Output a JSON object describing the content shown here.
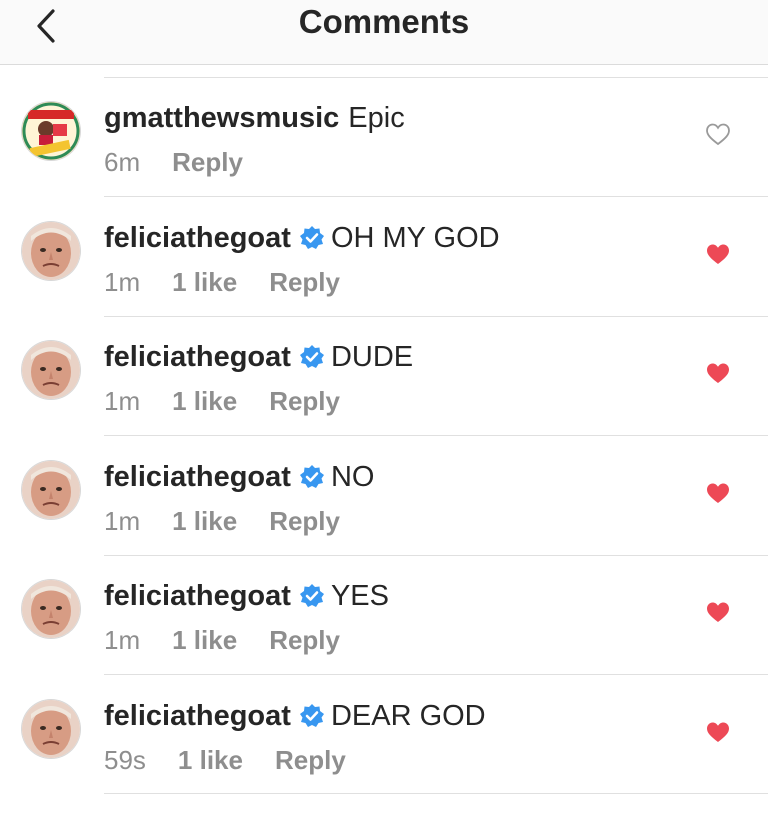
{
  "header": {
    "title": "Comments"
  },
  "comments": [
    {
      "username": "gmatthewsmusic",
      "verified": false,
      "text": "Epic",
      "time": "6m",
      "likes": "",
      "reply": "Reply",
      "liked": false,
      "avatar": "gmatthewsmusic-avatar"
    },
    {
      "username": "feliciathegoat",
      "verified": true,
      "text": "OH MY GOD",
      "time": "1m",
      "likes": "1 like",
      "reply": "Reply",
      "liked": true,
      "avatar": "feliciathegoat-avatar"
    },
    {
      "username": "feliciathegoat",
      "verified": true,
      "text": "DUDE",
      "time": "1m",
      "likes": "1 like",
      "reply": "Reply",
      "liked": true,
      "avatar": "feliciathegoat-avatar"
    },
    {
      "username": "feliciathegoat",
      "verified": true,
      "text": "NO",
      "time": "1m",
      "likes": "1 like",
      "reply": "Reply",
      "liked": true,
      "avatar": "feliciathegoat-avatar"
    },
    {
      "username": "feliciathegoat",
      "verified": true,
      "text": "YES",
      "time": "1m",
      "likes": "1 like",
      "reply": "Reply",
      "liked": true,
      "avatar": "feliciathegoat-avatar"
    },
    {
      "username": "feliciathegoat",
      "verified": true,
      "text": "DEAR GOD",
      "time": "59s",
      "likes": "1 like",
      "reply": "Reply",
      "liked": true,
      "avatar": "feliciathegoat-avatar"
    }
  ],
  "colors": {
    "liked_heart": "#ed4956",
    "verified": "#3897f0",
    "meta": "#8e8e8e",
    "text": "#262626"
  },
  "icons": {
    "back": "chevron-left-icon",
    "heart_empty": "heart-outline-icon",
    "heart_filled": "heart-filled-icon",
    "verified": "verified-badge-icon"
  }
}
